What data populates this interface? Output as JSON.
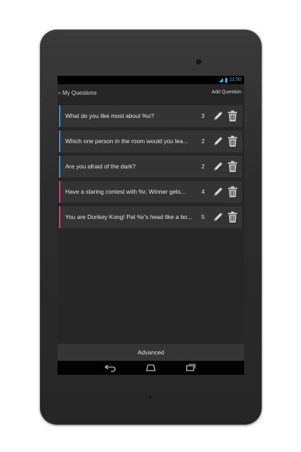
{
  "status": {
    "time": "11:50"
  },
  "actionbar": {
    "title": "My Questions",
    "add_label": "Add Question"
  },
  "questions": [
    {
      "text": "What do you like most about %o?",
      "count": "3",
      "accent": "blue"
    },
    {
      "text": "Which one person in the room would you lea...",
      "count": "2",
      "accent": "blue"
    },
    {
      "text": "Are you afraid of the dark?",
      "count": "2",
      "accent": "blue"
    },
    {
      "text": "Have a staring contest with %r. Winner gets...",
      "count": "4",
      "accent": "pink"
    },
    {
      "text": "You are Donkey Kong! Pat %r's head like a bo...",
      "count": "5",
      "accent": "pink"
    }
  ],
  "footer": {
    "advanced_label": "Advanced"
  },
  "icons": {
    "edit": "pencil-icon",
    "delete": "trash-icon",
    "back": "back-nav-icon",
    "home": "home-nav-icon",
    "recents": "recents-nav-icon"
  },
  "colors": {
    "accent_blue": "#3a8fd0",
    "accent_pink": "#d83a7a",
    "holo_blue": "#33b5e5"
  }
}
